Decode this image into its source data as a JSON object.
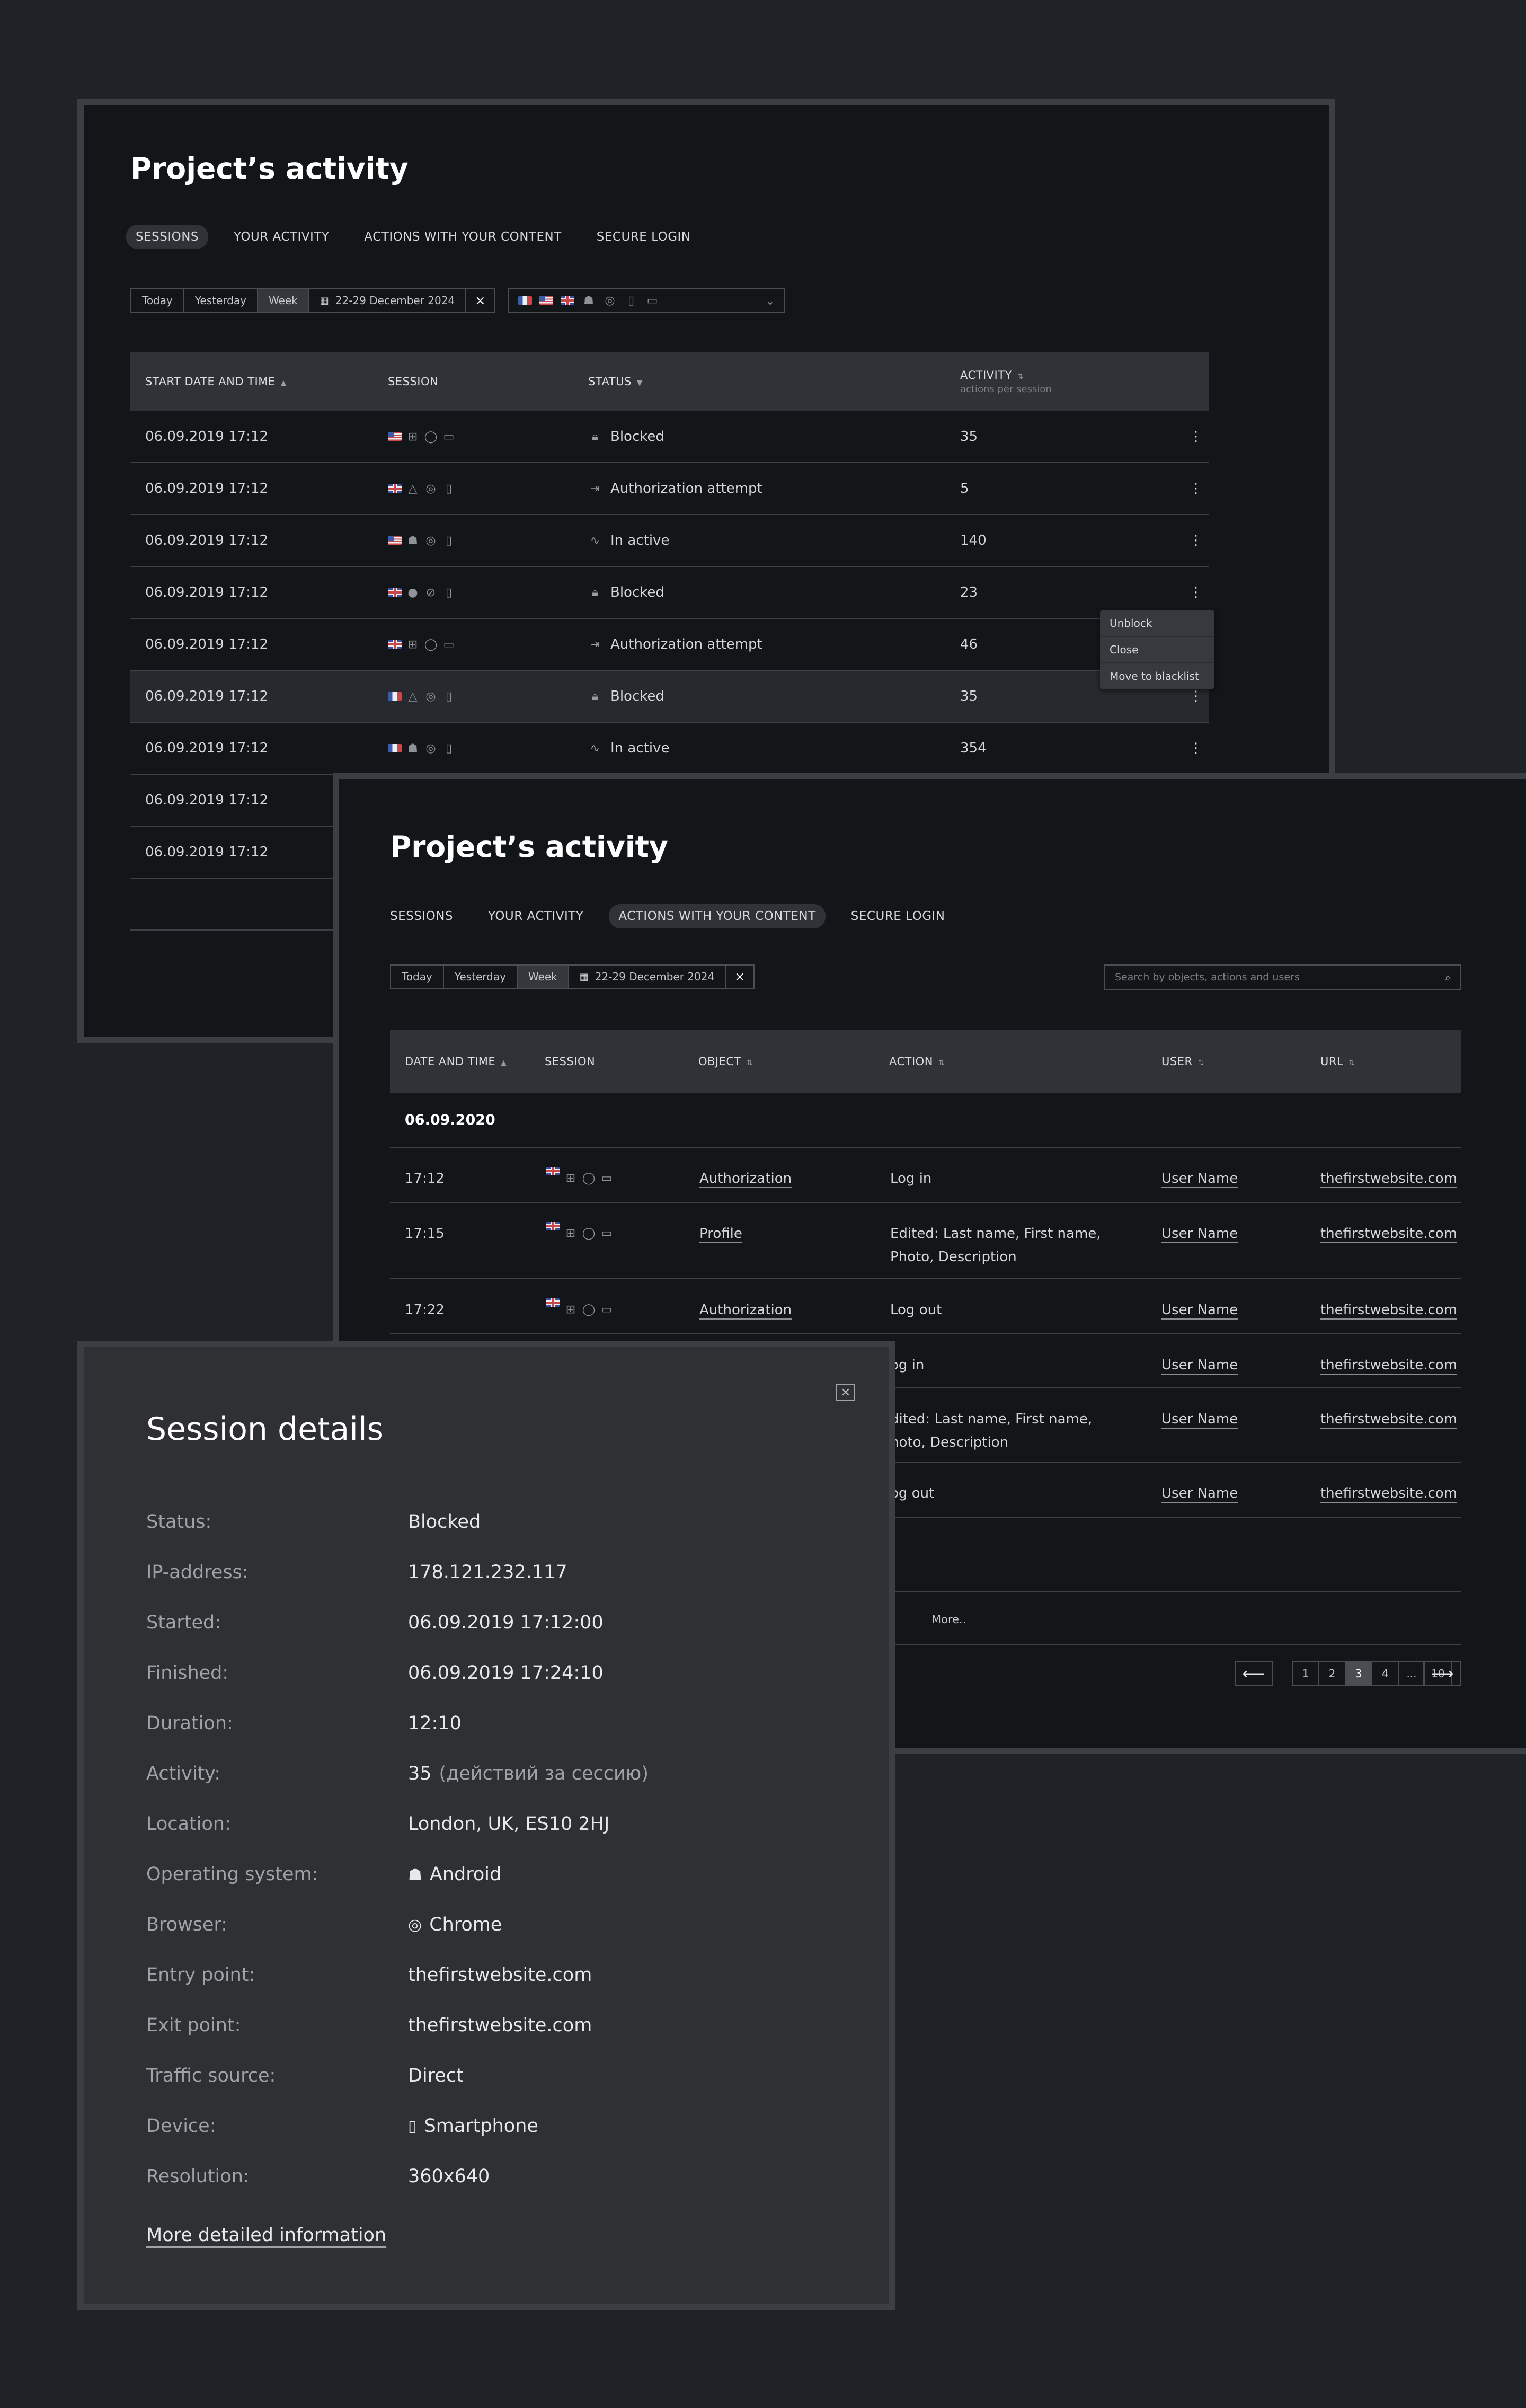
{
  "sessions_panel": {
    "title": "Project’s activity",
    "tabs": [
      {
        "label": "SESSIONS",
        "active": true
      },
      {
        "label": "YOUR ACTIVITY",
        "active": false
      },
      {
        "label": "ACTIONS WITH YOUR CONTENT",
        "active": false
      },
      {
        "label": "SECURE LOGIN",
        "active": false
      }
    ],
    "filter": {
      "today": "Today",
      "yesterday": "Yesterday",
      "week": "Week",
      "range": "22-29 December 2024",
      "close": "×"
    },
    "chip_icons": [
      "flag-fr",
      "flag-us",
      "flag-gb",
      "android-icon",
      "chrome-icon",
      "smartphone-icon",
      "desktop-icon",
      "chevron-down-icon"
    ],
    "headers": {
      "start": "START DATE AND TIME",
      "session": "SESSION",
      "status": "STATUS",
      "activity": "ACTIVITY",
      "activity_sub": "actions per session"
    },
    "rows": [
      {
        "date": "06.09.2019 17:12",
        "flag": "us",
        "os": "windows",
        "browser": "opera",
        "device": "desktop",
        "status": "Blocked",
        "status_icon": "lock-icon",
        "activity": "35"
      },
      {
        "date": "06.09.2019 17:12",
        "flag": "gb",
        "os": "linux",
        "browser": "chrome",
        "device": "tablet",
        "status": "Authorization attempt",
        "status_icon": "login-icon",
        "activity": "5"
      },
      {
        "date": "06.09.2019 17:12",
        "flag": "us",
        "os": "android",
        "browser": "chrome",
        "device": "smartphone",
        "status": "In active",
        "status_icon": "pulse-icon",
        "activity": "140"
      },
      {
        "date": "06.09.2019 17:12",
        "flag": "gb",
        "os": "apple",
        "browser": "safari",
        "device": "smartphone",
        "status": "Blocked",
        "status_icon": "lock-icon",
        "activity": "23"
      },
      {
        "date": "06.09.2019 17:12",
        "flag": "gb",
        "os": "windows",
        "browser": "opera",
        "device": "desktop",
        "status": "Authorization attempt",
        "status_icon": "login-icon",
        "activity": "46"
      },
      {
        "date": "06.09.2019 17:12",
        "flag": "fr",
        "os": "linux",
        "browser": "chrome",
        "device": "tablet",
        "status": "Blocked",
        "status_icon": "lock-icon",
        "activity": "35"
      },
      {
        "date": "06.09.2019 17:12",
        "flag": "fr",
        "os": "android",
        "browser": "chrome",
        "device": "smartphone",
        "status": "In active",
        "status_icon": "pulse-icon",
        "activity": "354"
      },
      {
        "date": "06.09.2019 17:12"
      },
      {
        "date": "06.09.2019 17:12"
      }
    ],
    "context_menu": [
      "Unblock",
      "Close",
      "Move to blacklist"
    ],
    "more_glyph": "⋮"
  },
  "content_panel": {
    "title": "Project’s activity",
    "tabs": [
      {
        "label": "SESSIONS",
        "active": false
      },
      {
        "label": "YOUR ACTIVITY",
        "active": false
      },
      {
        "label": "ACTIONS WITH YOUR CONTENT",
        "active": true
      },
      {
        "label": "SECURE LOGIN",
        "active": false
      }
    ],
    "filter": {
      "today": "Today",
      "yesterday": "Yesterday",
      "week": "Week",
      "range": "22-29 December 2024",
      "close": "×"
    },
    "search_placeholder": "Search by objects, actions and users",
    "headers": {
      "date": "DATE AND TIME",
      "session": "SESSION",
      "object": "OBJECT",
      "action": "ACTION",
      "user": "USER",
      "url": "URL"
    },
    "group_date": "06.09.2020",
    "rows": [
      {
        "time": "17:12",
        "object": "Authorization",
        "action": "Log in",
        "user": "User Name",
        "url": "thefirstwebsite.com"
      },
      {
        "time": "17:15",
        "object": "Profile",
        "action": "Edited: Last name, First name, Photo, Description",
        "user": "User Name",
        "url": "thefirstwebsite.com"
      },
      {
        "time": "17:22",
        "object": "Authorization",
        "action": "Log out",
        "user": "User Name",
        "url": "thefirstwebsite.com"
      }
    ],
    "rows2": [
      {
        "action": "og in",
        "user": "User Name",
        "url": "thefirstwebsite.com"
      },
      {
        "action": "dited: Last name, First name, hoto, Description",
        "user": "User Name",
        "url": "thefirstwebsite.com"
      },
      {
        "action": "og out",
        "user": "User Name",
        "url": "thefirstwebsite.com"
      }
    ],
    "more": "More..",
    "pager": {
      "prev": "⟵",
      "next": "⟶",
      "pages": [
        "1",
        "2",
        "3",
        "4",
        "...",
        "10"
      ],
      "current": "3"
    }
  },
  "details": {
    "title": "Session details",
    "close": "✕",
    "fields": [
      {
        "label": "Status:",
        "value": "Blocked"
      },
      {
        "label": "IP-address:",
        "value": "178.121.232.117"
      },
      {
        "label": "Started:",
        "value": "06.09.2019 17:12:00"
      },
      {
        "label": "Finished:",
        "value": "06.09.2019 17:24:10"
      },
      {
        "label": "Duration:",
        "value": "12:10"
      },
      {
        "label": "Activity:",
        "value": "35",
        "note": "(действий за сессию)"
      },
      {
        "label": "Location:",
        "value": "London, UK, ES10 2HJ"
      },
      {
        "label": "Operating system:",
        "value": "Android",
        "icon": "android-icon"
      },
      {
        "label": "Browser:",
        "value": "Chrome",
        "icon": "chrome-icon"
      },
      {
        "label": "Entry point:",
        "value": "thefirstwebsite.com"
      },
      {
        "label": "Exit point:",
        "value": "thefirstwebsite.com"
      },
      {
        "label": "Traffic source:",
        "value": "Direct"
      },
      {
        "label": "Device:",
        "value": "Smartphone",
        "icon": "smartphone-icon"
      },
      {
        "label": "Resolution:",
        "value": "360x640"
      }
    ],
    "more_link": "More detailed information"
  }
}
